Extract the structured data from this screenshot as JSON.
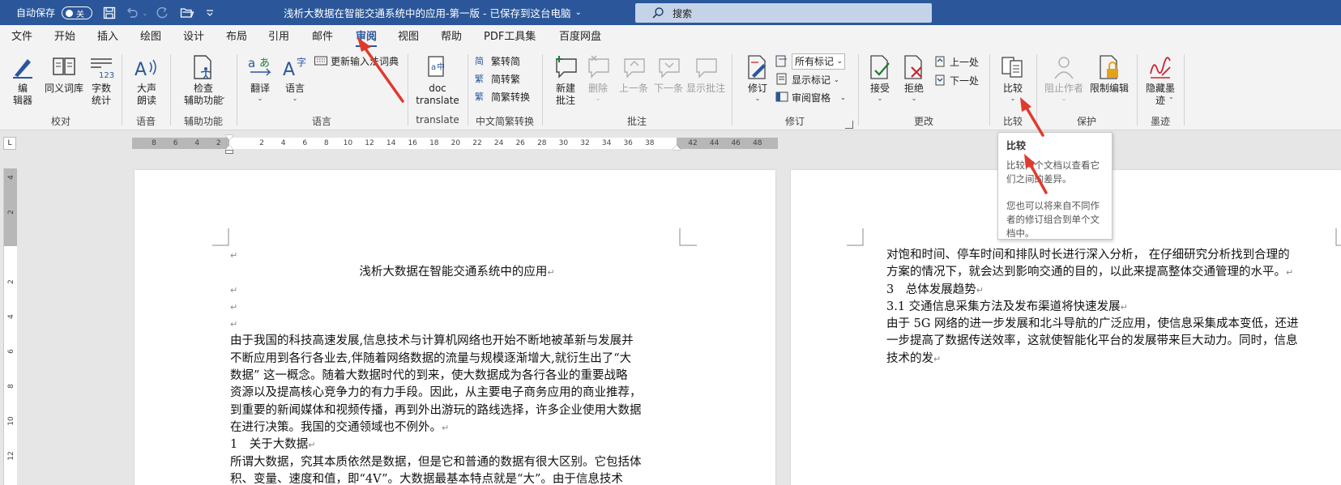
{
  "titlebar": {
    "autosave_label": "自动保存",
    "autosave_state": "关",
    "document_title": "浅析大数据在智能交通系统中的应用-第一版 - 已保存到这台电脑",
    "title_dropdown": "⌄",
    "search_placeholder": "搜索"
  },
  "tabs": [
    "文件",
    "开始",
    "插入",
    "绘图",
    "设计",
    "布局",
    "引用",
    "邮件",
    "审阅",
    "视图",
    "帮助",
    "PDF工具集",
    "百度网盘"
  ],
  "active_tab": "审阅",
  "ribbon": {
    "proofing": {
      "editor": "编\n辑器",
      "thesaurus": "同义词库",
      "word_count": "字数\n统计",
      "label": "校对"
    },
    "speech": {
      "read_aloud": "大声\n朗读",
      "label": "语音"
    },
    "accessibility": {
      "check": "检查\n辅助功能",
      "label": "辅助功能"
    },
    "language": {
      "translate": "翻译",
      "language": "语言",
      "update_ime": "更新输入法词典",
      "label": "语言"
    },
    "translate_group": {
      "doc_translate": "doc\ntranslate",
      "label": "translate"
    },
    "chinese_conversion": {
      "to_simplified": "繁转简",
      "to_traditional": "简转繁",
      "convert": "简繁转换",
      "label": "中文简繁转换"
    },
    "comments": {
      "new": "新建\n批注",
      "delete": "删除",
      "previous": "上一条",
      "next": "下一条",
      "show": "显示批注",
      "label": "批注"
    },
    "tracking": {
      "track_changes": "修订",
      "markup_select": "所有标记",
      "show_markup": "显示标记",
      "reviewing_pane": "审阅窗格",
      "label": "修订"
    },
    "changes": {
      "accept": "接受",
      "reject": "拒绝",
      "previous": "上一处",
      "next": "下一处",
      "label": "更改"
    },
    "compare": {
      "compare": "比较",
      "label": "比较"
    },
    "protect": {
      "block_authors": "阻止作者",
      "restrict_editing": "限制编辑",
      "label": "保护"
    },
    "ink": {
      "hide_ink": "隐藏墨\n迹",
      "label": "墨迹"
    }
  },
  "ruler": {
    "ticks": [
      "8",
      "6",
      "4",
      "2",
      "",
      "2",
      "4",
      "6",
      "8",
      "10",
      "12",
      "14",
      "16",
      "18",
      "20",
      "22",
      "24",
      "26",
      "28",
      "30",
      "32",
      "34",
      "36",
      "38",
      "",
      "42",
      "44",
      "46",
      "48"
    ],
    "vticks": [
      "4",
      "2",
      "",
      "2",
      "4",
      "6",
      "8",
      "10",
      "12"
    ],
    "corner": "L"
  },
  "tooltip": {
    "title": "比较",
    "line1": "比较两个文档以查看它们之间的差异。",
    "line2": "您也可以将来自不同作者的修订组合到单个文档中。"
  },
  "page1": {
    "title": "浅析大数据在智能交通系统中的应用",
    "para1": [
      "由于我国的科技高速发展,信息技术与计算机网络也开始不断地被革新与发展并",
      "不断应用到各行各业去,伴随着网络数据的流量与规模逐渐增大,就衍生出了“大",
      "数据” 这一概念。随着大数据时代的到来，使大数据成为各行各业的重要战略",
      "资源以及提高核心竞争力的有力手段。因此，从主要电子商务应用的商业推荐，",
      "到重要的新闻媒体和视频传播，再到外出游玩的路线选择，许多企业使用大数据",
      "在进行决策。我国的交通领域也不例外。"
    ],
    "heading1": "1　关于大数据",
    "para2": [
      "所谓大数据，究其本质依然是数据，但是它和普通的数据有很大区别。它包括体",
      "积、变量、速度和值，即“4V”。大数据最基本特点就是“大”。由于信息技术"
    ]
  },
  "page2": {
    "para1": [
      "对饱和时间、停车时间和排队时长进行深入分析，  在仔细研究分析找到合理的",
      "方案的情况下，就会达到影响交通的目的，以此来提高整体交通管理的水平。"
    ],
    "heading3": "3　总体发展趋势",
    "heading31": "3.1 交通信息采集方法及发布渠道将快速发展",
    "para2": [
      "由于 5G 网络的进一步发展和北斗导航的广泛应用，使信息采集成本变低，还进",
      "一步提高了数据传送效率，这就使智能化平台的发展带来巨大动力。同时，信息",
      "技术的发"
    ]
  },
  "colors": {
    "accent": "#2b579a",
    "arrow": "#e03a2f"
  }
}
